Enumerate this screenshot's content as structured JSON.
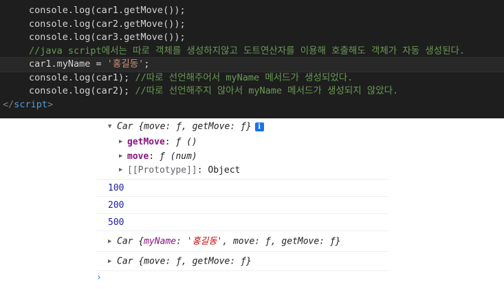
{
  "editor": {
    "lines": [
      {
        "code": "console.log(car1.getMove());"
      },
      {
        "code": "console.log(car2.getMove());"
      },
      {
        "code": "console.log(car3.getMove());"
      },
      {
        "comment": "//java script에서는 따로 객체를 생성하지않고 도트연산자를 이용해 호출해도 객체가 자동 생성된다."
      },
      {
        "code": "car1.myName = ",
        "string": "'홍길동'",
        "tail": ";"
      },
      {
        "code": "console.log(car1); ",
        "comment": "//따로 선언해주어서 myName 메서드가 생성되었다."
      },
      {
        "code": "console.log(car2); ",
        "comment": "//따로 선언해주지 않아서 myName 메서드가 생성되지 않았다."
      }
    ],
    "closing_tag": {
      "open": "</",
      "name": "script",
      "close": ">"
    }
  },
  "console": {
    "expanded_object": {
      "class_name": "Car",
      "summary": "{move: ƒ, getMove: ƒ}",
      "info_icon": "i",
      "props": [
        {
          "name": "getMove",
          "sep": ": ",
          "value": "ƒ ()"
        },
        {
          "name": "move",
          "sep": ": ",
          "value": "ƒ (num)"
        },
        {
          "name": "[[Prototype]]",
          "sep": ": ",
          "value": "Object"
        }
      ]
    },
    "numbers": [
      "100",
      "200",
      "500"
    ],
    "car1_log": {
      "class_name": "Car",
      "open": "{",
      "key1": "myName",
      "str1": "'홍길동'",
      "rest": ", move: ƒ, getMove: ƒ}"
    },
    "car2_log": {
      "class_name": "Car",
      "summary": "{move: ƒ, getMove: ƒ}"
    },
    "prompt": "›"
  },
  "colors": {
    "editor_bg": "#1e1e1e",
    "comment": "#6a9955",
    "string": "#ce9178",
    "tag": "#569cd6",
    "console_number": "#1a1aa6",
    "console_key": "#881280",
    "console_string": "#c80000"
  }
}
